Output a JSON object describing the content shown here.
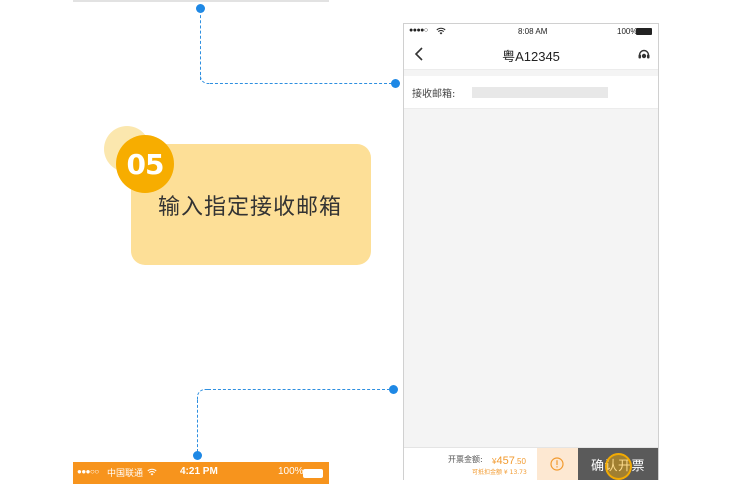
{
  "step": {
    "number": "05",
    "text": "输入指定接收邮箱"
  },
  "phone": {
    "status": {
      "signal": "●●●●○",
      "time": "8:08 AM",
      "battery": "100%"
    },
    "nav": {
      "title": "粤A12345"
    },
    "email": {
      "label": "接收邮箱:",
      "value": ""
    },
    "bottom": {
      "amount_label": "开票金额:",
      "currency": "¥",
      "amount_main": "457",
      "amount_cents": ".50",
      "deduct_label": "可抵扣金额 ¥ 13.73",
      "confirm_label": "确认开票"
    }
  },
  "prev_phone": {
    "status": {
      "signal": "●●●○○",
      "carrier": "中国联通",
      "time": "4:21 PM",
      "battery": "100%"
    }
  },
  "colors": {
    "accent_orange": "#f7ad00",
    "card_yellow": "#fddf97",
    "connector_blue": "#2e8fe0",
    "amount_orange": "#f29a2e",
    "confirm_gray": "#5a5a5a"
  }
}
